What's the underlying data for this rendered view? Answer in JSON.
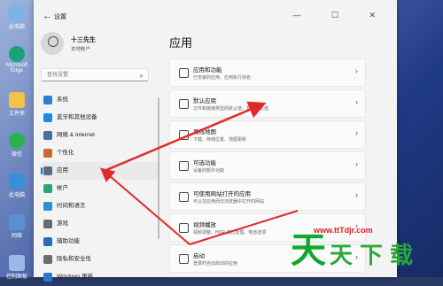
{
  "desktop": {
    "icons": [
      {
        "label": "此电脑",
        "icon": "computer-icon",
        "color": "#7fb3e8"
      },
      {
        "label": "Microsoft Edge",
        "icon": "edge-icon",
        "color": "#1aa37a"
      },
      {
        "label": "文件夹",
        "icon": "folder-icon",
        "color": "#f2c24a"
      },
      {
        "label": "微信",
        "icon": "wechat-icon",
        "color": "#2bb24c"
      },
      {
        "label": "此电脑",
        "icon": "monitor-icon",
        "color": "#3a8fd9"
      },
      {
        "label": "网络",
        "icon": "network-icon",
        "color": "#5a8fd0"
      },
      {
        "label": "控制面板",
        "icon": "control-panel-icon",
        "color": "#9cb9e6"
      }
    ]
  },
  "window": {
    "title": "设置",
    "back_glyph": "←",
    "controls": "— ☐ ✕"
  },
  "profile": {
    "name": "十三先生",
    "account_type": "本地帐户"
  },
  "search": {
    "placeholder": "查找设置",
    "icon": "search-icon"
  },
  "nav": {
    "items": [
      {
        "label": "系统",
        "icon": "system-icon",
        "color": "#2d7dd2"
      },
      {
        "label": "蓝牙和其他设备",
        "icon": "bluetooth-icon",
        "color": "#1e88e5"
      },
      {
        "label": "网络 & Internet",
        "icon": "network-icon",
        "color": "#4a6fa5"
      },
      {
        "label": "个性化",
        "icon": "personalization-icon",
        "color": "#c96a2b"
      },
      {
        "label": "应用",
        "icon": "apps-icon",
        "color": "#5d6b80",
        "selected": true
      },
      {
        "label": "帐户",
        "icon": "account-icon",
        "color": "#2aa86b"
      },
      {
        "label": "时间和语言",
        "icon": "time-language-icon",
        "color": "#2f8fd8"
      },
      {
        "label": "游戏",
        "icon": "gaming-icon",
        "color": "#6a6a6a"
      },
      {
        "label": "辅助功能",
        "icon": "accessibility-icon",
        "color": "#2b6cb0"
      },
      {
        "label": "隐私和安全性",
        "icon": "privacy-icon",
        "color": "#6b6b6b"
      },
      {
        "label": "Windows 更新",
        "icon": "update-icon",
        "color": "#2a78d0"
      }
    ]
  },
  "main": {
    "title": "应用",
    "cards": [
      {
        "title": "应用和功能",
        "desc": "已安装的应用，应用执行别名",
        "icon": "apps-features-icon"
      },
      {
        "title": "默认应用",
        "desc": "文件和链接类型的默认值，其他默认值",
        "icon": "default-apps-icon"
      },
      {
        "title": "离线地图",
        "desc": "下载、存储位置、地图更新",
        "icon": "offline-maps-icon"
      },
      {
        "title": "可选功能",
        "desc": "设备的额外功能",
        "icon": "optional-features-icon"
      },
      {
        "title": "可使用网站打开的应用",
        "desc": "可以在应用而非浏览器中打开的网站",
        "icon": "apps-for-websites-icon"
      },
      {
        "title": "视频播放",
        "desc": "视频调整、HDR 流式处理、电池选项",
        "icon": "video-playback-icon"
      },
      {
        "title": "启动",
        "desc": "登录时自动启动的应用",
        "icon": "startup-icon"
      }
    ],
    "chevron": "›"
  },
  "watermark": {
    "glyph1": "天",
    "glyph2": "天",
    "glyph3": "下",
    "glyph4": "载",
    "url": "www.ttTdjr.com"
  },
  "colors": {
    "accent": "#1a6ed8",
    "arrow": "#e02a2a"
  }
}
